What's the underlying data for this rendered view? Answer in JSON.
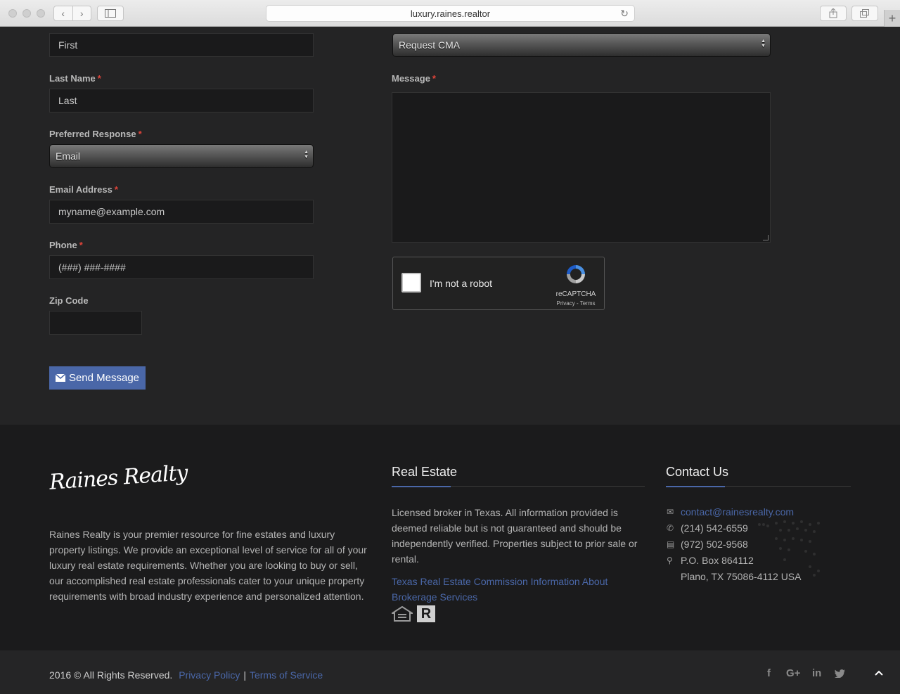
{
  "browser": {
    "url": "luxury.raines.realtor",
    "back_icon": "‹",
    "forward_icon": "›",
    "reload_icon": "↻",
    "newtab_icon": "+"
  },
  "form": {
    "first_value": "First",
    "last_label": "Last Name",
    "last_value": "Last",
    "preferred_label": "Preferred Response",
    "preferred_value": "Email",
    "email_label": "Email Address",
    "email_placeholder": "myname@example.com",
    "phone_label": "Phone",
    "phone_placeholder": "(###) ###-####",
    "zip_label": "Zip Code",
    "zip_value": "",
    "request_value": "Request CMA",
    "message_label": "Message",
    "required_mark": "*",
    "captcha_text": "I'm not a robot",
    "captcha_brand": "reCAPTCHA",
    "captcha_links": "Privacy - Terms",
    "send_label": "Send Message"
  },
  "footer": {
    "logo_text": "Raines Realty",
    "about": "Raines Realty is your premier resource for fine estates and luxury property listings. We provide an exceptional level of service for all of your luxury real estate requirements. Whether you are looking to buy or sell, our accomplished real estate professionals cater to your unique property requirements with broad industry experience and personalized attention.",
    "real_estate_title": "Real Estate",
    "real_estate_text": "Licensed broker in Texas. All information provided is deemed reliable but is not guaranteed and should be independently verified. Properties subject to prior sale or rental.",
    "trec_link": "Texas Real Estate Commission Information About Brokerage Services",
    "contact_title": "Contact Us",
    "email": "contact@rainesrealty.com",
    "phone": "(214) 542-6559",
    "fax": "(972) 502-9568",
    "address1": "P.O. Box 864112",
    "address2": "Plano, TX 75086-4112 USA",
    "realtor_badge": "R"
  },
  "bottom": {
    "copyright": "2016 © All Rights Reserved.",
    "privacy": "Privacy Policy",
    "divider": "|",
    "terms": "Terms of Service",
    "social_facebook": "f",
    "social_google": "G+",
    "social_linkedin": "in",
    "social_twitter": "t",
    "to_top": "^"
  },
  "colors": {
    "accent": "#4a67a8",
    "required": "#e0443a",
    "background": "#242425",
    "footer": "#1b1b1c"
  }
}
